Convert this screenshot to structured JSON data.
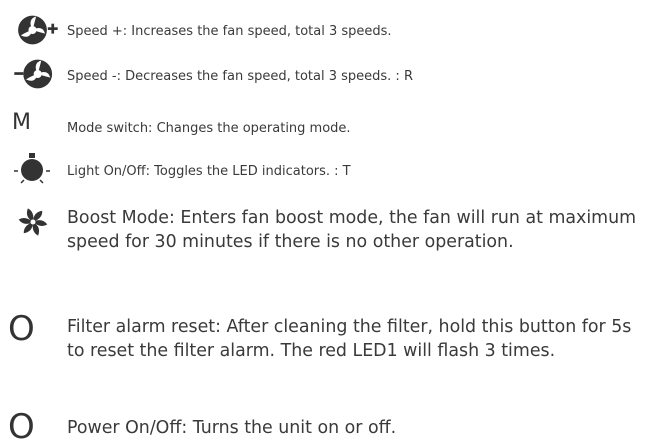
{
  "items": [
    {
      "icon": "fan-speed-plus-icon",
      "text": "Speed +: Increases the fan speed, total 3 speeds."
    },
    {
      "icon": "fan-speed-minus-icon",
      "text": "Speed -: Decreases the fan speed, total 3 speeds. : R"
    },
    {
      "icon": "mode-letter-icon",
      "glyph": "M",
      "text": "Mode switch: Changes the operating mode."
    },
    {
      "icon": "light-bulb-icon",
      "text": "Light On/Off: Toggles the LED indicators. : T"
    },
    {
      "icon": "boost-fan-icon",
      "text": "Boost Mode: Enters fan boost mode, the fan will run at maximum speed for 30 minutes if there is no other operation."
    },
    {
      "icon": "filter-reset-icon",
      "glyph": "O",
      "text": "Filter alarm reset: After cleaning the filter, hold this button for 5s to reset the filter alarm. The red LED1 will flash 3 times."
    },
    {
      "icon": "power-icon",
      "glyph": "O",
      "text": "Power On/Off: Turns the unit on or off."
    }
  ],
  "colors": {
    "text": "#3a3a3a",
    "icon": "#333333"
  }
}
